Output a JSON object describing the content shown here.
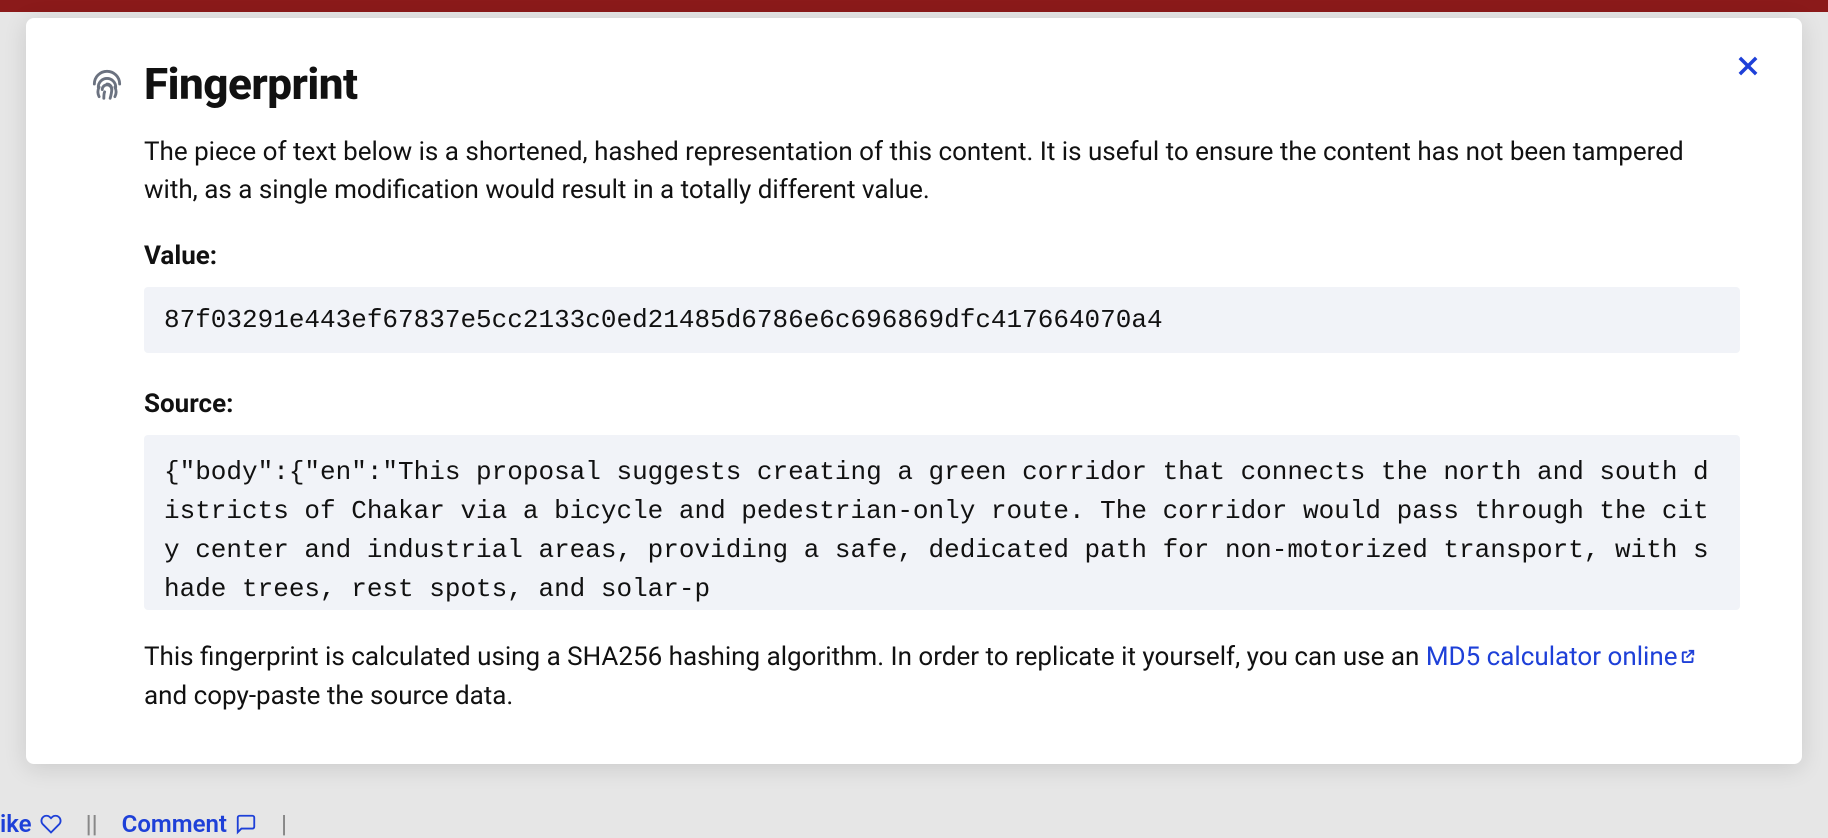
{
  "modal": {
    "title": "Fingerprint",
    "description": "The piece of text below is a shortened, hashed representation of this content. It is useful to ensure the content has not been tampered with, as a single modification would result in a totally different value.",
    "value_label": "Value:",
    "value": "87f03291e443ef67837e5cc2133c0ed21485d6786e6c696869dfc417664070a4",
    "source_label": "Source:",
    "source": "{\"body\":{\"en\":\"This proposal suggests creating a green corridor that connects the north and south districts of Chakar via a bicycle and pedestrian-only route. The corridor would pass through the city center and industrial areas, providing a safe, dedicated path for non-motorized transport, with shade trees, rest spots, and solar-p",
    "footnote_prefix": "This fingerprint is calculated using a SHA256 hashing algorithm. In order to replicate it yourself, you can use an ",
    "footnote_link": "MD5 calculator online",
    "footnote_suffix": " and copy-paste the source data."
  },
  "background": {
    "like_label": "ike",
    "comment_label": "Comment"
  }
}
